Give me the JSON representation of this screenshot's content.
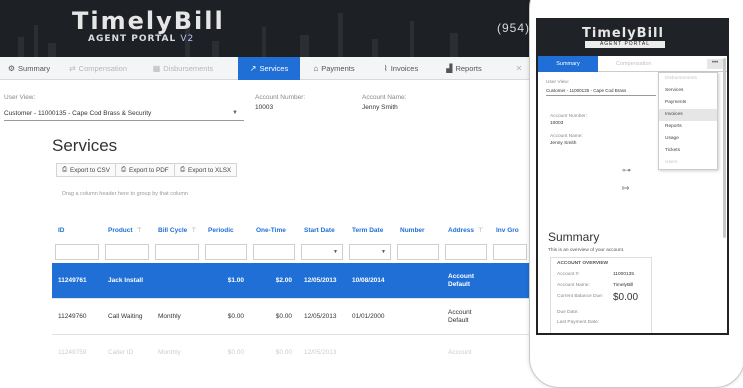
{
  "header": {
    "logo_main": "TimelyBill",
    "logo_sub": "AGENT PORTAL",
    "logo_ver": "V2",
    "phone_partial": "(954)"
  },
  "nav": {
    "tabs": [
      {
        "label": "Summary",
        "icon": "gear-icon",
        "glyph": "⚙",
        "state": "normal"
      },
      {
        "label": "Compensation",
        "icon": "money-icon",
        "glyph": "⇄",
        "state": "dim"
      },
      {
        "label": "Disbursements",
        "icon": "calendar-icon",
        "glyph": "▦",
        "state": "dim"
      },
      {
        "label": "Services",
        "icon": "wrench-icon",
        "glyph": "↗",
        "state": "active"
      },
      {
        "label": "Payments",
        "icon": "bank-icon",
        "glyph": "⌂",
        "state": "normal"
      },
      {
        "label": "Invoices",
        "icon": "paperclip-icon",
        "glyph": "⌇",
        "state": "normal"
      },
      {
        "label": "Reports",
        "icon": "chart-icon",
        "glyph": "▟",
        "state": "normal"
      },
      {
        "label": "",
        "icon": "close-icon",
        "glyph": "✕",
        "state": "dim"
      }
    ]
  },
  "context": {
    "user_view_label": "User View:",
    "customer_value": "Customer - 11000135 - Cape Cod Brass & Security",
    "account_number_label": "Account Number:",
    "account_number": "10003",
    "account_name_label": "Account Name:",
    "account_name": "Jenny Smith"
  },
  "page_title": "Services",
  "exports": [
    "Export to CSV",
    "Export to PDF",
    "Export to XLSX"
  ],
  "group_hint": "Drag a column header here to group by that column",
  "grid": {
    "columns": [
      "ID",
      "Product",
      "Bill Cycle",
      "Periodic",
      "One-Time",
      "Start Date",
      "Term Date",
      "Number",
      "Address",
      "Inv Gro"
    ],
    "rows": [
      {
        "id": "11249761",
        "product": "Jack Install",
        "bill_cycle": "",
        "periodic": "$1.00",
        "one_time": "$2.00",
        "start": "12/05/2013",
        "term": "10/08/2014",
        "number": "",
        "address": "Account Default",
        "inv": ""
      },
      {
        "id": "11249760",
        "product": "Call Waiting",
        "bill_cycle": "Monthly",
        "periodic": "$0.00",
        "one_time": "$0.00",
        "start": "12/05/2013",
        "term": "01/01/2000",
        "number": "",
        "address": "Account Default",
        "inv": ""
      },
      {
        "id": "11249759",
        "product": "Caller ID",
        "bill_cycle": "Monthly",
        "periodic": "$0.00",
        "one_time": "$0.00",
        "start": "12/05/2013",
        "term": "",
        "number": "",
        "address": "Account",
        "inv": ""
      }
    ]
  },
  "colors": {
    "accent": "#1f6fd6",
    "header_bg": "#1d2024"
  },
  "phone": {
    "logo": "TimelyBill",
    "logo_sub": "AGENT PORTAL",
    "tab_summary": "Summary",
    "tab_comp": "Compensation",
    "more": "•••",
    "menu": [
      {
        "label": "Disbursements",
        "state": "dim"
      },
      {
        "label": "Services",
        "state": "normal"
      },
      {
        "label": "Payments",
        "state": "normal"
      },
      {
        "label": "Invoices",
        "state": "hl"
      },
      {
        "label": "Reports",
        "state": "normal"
      },
      {
        "label": "Usage",
        "state": "normal"
      },
      {
        "label": "Tickets",
        "state": "normal"
      },
      {
        "label": "Users",
        "state": "dim"
      }
    ],
    "user_view_label": "User View:",
    "customer_value": "Customer - 11000135 - Cape Cod Brass",
    "acct_num_label": "Account Number:",
    "acct_num": "10003",
    "acct_name_label": "Account Name:",
    "acct_name": "Jenny Smith",
    "summary_title": "Summary",
    "summary_desc": "This is an overview of your account.",
    "overview_title": "ACCOUNT OVERVIEW",
    "ov_acct_label": "Account #:",
    "ov_acct": "11000135",
    "ov_name_label": "Account Name:",
    "ov_name": "TimelyBill",
    "ov_bal_label": "Current Balance Due:",
    "ov_bal": "$0.00",
    "ov_due_label": "Due Date:",
    "ov_last_label": "Last Payment Date:"
  }
}
